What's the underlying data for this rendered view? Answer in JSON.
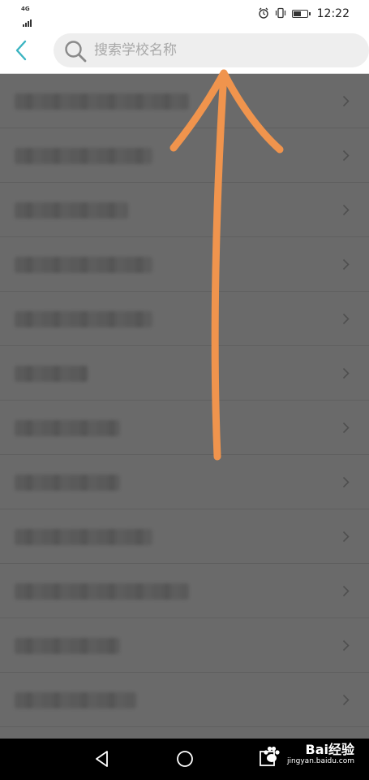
{
  "status_bar": {
    "network": "4G",
    "time": "12:22",
    "battery_level": 0.6,
    "icons": [
      "alarm-icon",
      "vibrate-icon",
      "battery-icon"
    ]
  },
  "header": {
    "back_icon": "chevron-left-icon",
    "search": {
      "placeholder": "搜索学校名称",
      "value": ""
    }
  },
  "school_list": {
    "count": 12,
    "chevron_icon": "chevron-right-icon"
  },
  "nav_bar": {
    "buttons": [
      "back-triangle-icon",
      "home-circle-icon",
      "recents-square-icon"
    ]
  },
  "watermark": {
    "brand": "Bai",
    "brand2": "经验",
    "url": "jingyan.baidu.com"
  },
  "colors": {
    "accent": "#3bb4c1",
    "arrow": "#f0944d",
    "overlay": "#6a6a6a"
  }
}
